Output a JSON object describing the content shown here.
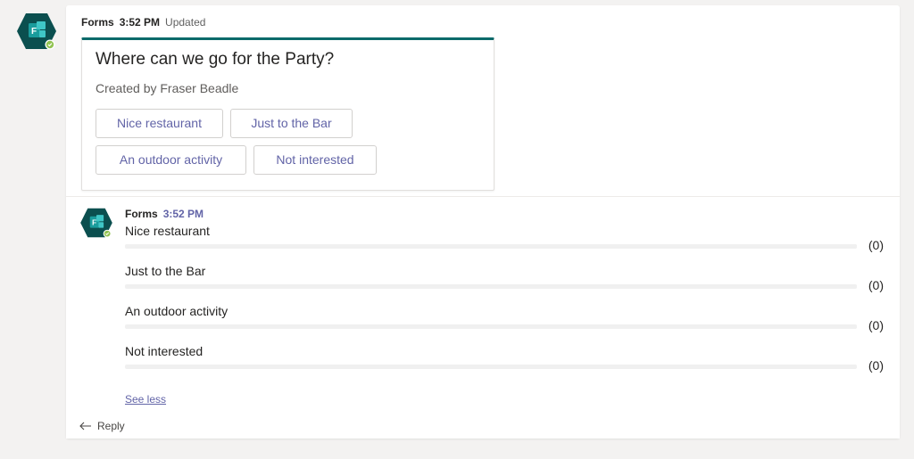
{
  "post": {
    "author": "Forms",
    "time": "3:52 PM",
    "status": "Updated",
    "avatar_icon": "forms-app-icon",
    "presence": "available",
    "card": {
      "accent_color": "#0b6a6a",
      "title": "Where can we go for the Party?",
      "subtitle": "Created by Fraser Beadle",
      "options": [
        "Nice restaurant",
        "Just to the Bar",
        "An outdoor activity",
        "Not interested"
      ]
    }
  },
  "reply": {
    "author": "Forms",
    "time": "3:52 PM",
    "avatar_icon": "forms-app-icon",
    "results": [
      {
        "label": "Nice restaurant",
        "count": "(0)",
        "fraction": 0
      },
      {
        "label": "Just to the Bar",
        "count": "(0)",
        "fraction": 0
      },
      {
        "label": "An outdoor activity",
        "count": "(0)",
        "fraction": 0
      },
      {
        "label": "Not interested",
        "count": "(0)",
        "fraction": 0
      }
    ],
    "see_less": "See less",
    "reply_label": "Reply"
  },
  "colors": {
    "brand": "#6264a7",
    "forms_teal": "#0b6a6a",
    "presence_green": "#92c353"
  }
}
